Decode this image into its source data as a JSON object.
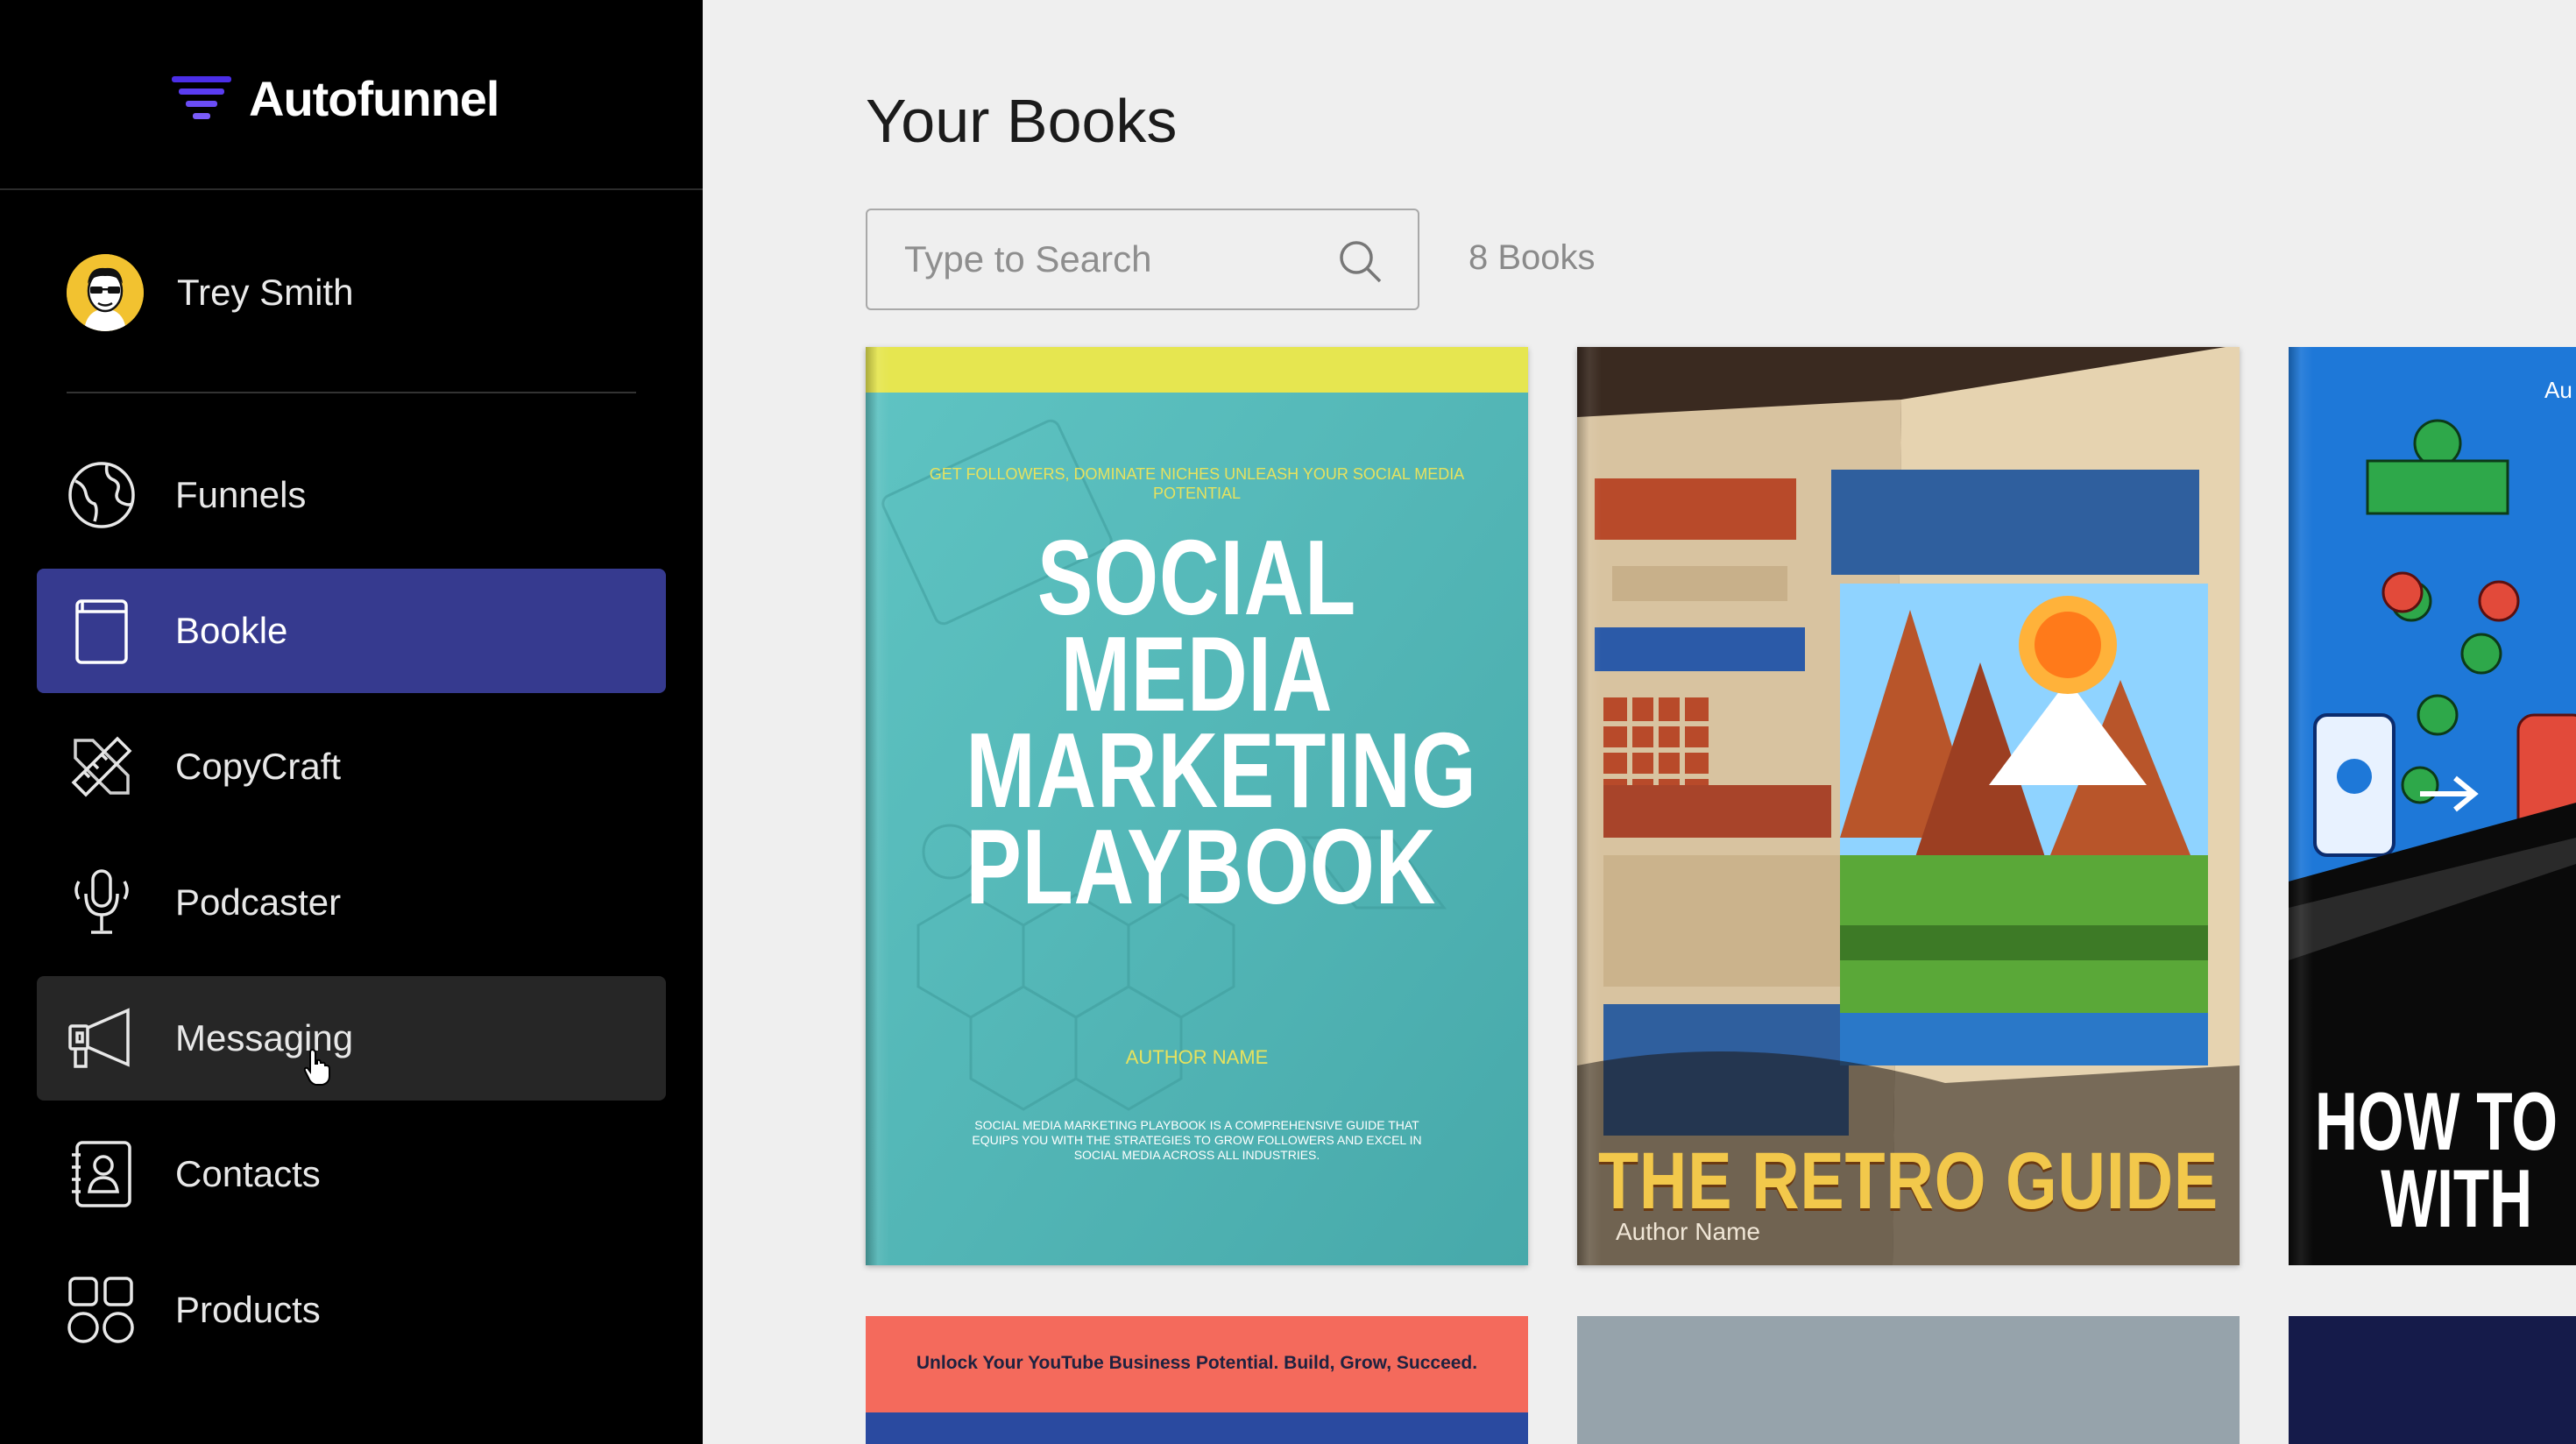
{
  "app": {
    "name": "Autofunnel"
  },
  "user": {
    "name": "Trey Smith"
  },
  "sidebar": {
    "items": [
      {
        "label": "Funnels",
        "icon": "globe-icon",
        "state": "default"
      },
      {
        "label": "Bookle",
        "icon": "book-icon",
        "state": "active"
      },
      {
        "label": "CopyCraft",
        "icon": "pencil-ruler-icon",
        "state": "default"
      },
      {
        "label": "Podcaster",
        "icon": "microphone-icon",
        "state": "default"
      },
      {
        "label": "Messaging",
        "icon": "megaphone-icon",
        "state": "hover"
      },
      {
        "label": "Contacts",
        "icon": "contact-book-icon",
        "state": "default"
      },
      {
        "label": "Products",
        "icon": "grid-shapes-icon",
        "state": "default"
      }
    ]
  },
  "main": {
    "title": "Your Books",
    "search": {
      "placeholder": "Type to Search",
      "value": ""
    },
    "count_label": "8 Books",
    "books": [
      {
        "tagline": "Get followers, dominate niches unleash your social media potential",
        "title": "SOCIAL MEDIA MARKETING PLAYBOOK",
        "author": "AUTHOR NAME",
        "description": "Social Media Marketing Playbook is a comprehensive guide that equips you with the strategies to grow followers and excel in social media across all industries."
      },
      {
        "title": "THE RETRO GUIDE",
        "author": "Author Name"
      },
      {
        "title": "HOW TO M WITH"
      },
      {
        "banner": "Unlock Your YouTube Business Potential. Build, Grow, Succeed."
      }
    ]
  },
  "colors": {
    "sidebar_bg": "#000000",
    "active_item": "#363a8f",
    "hover_item": "#262626",
    "brand_accent": "#4b2ee8",
    "main_bg": "#efefef"
  }
}
